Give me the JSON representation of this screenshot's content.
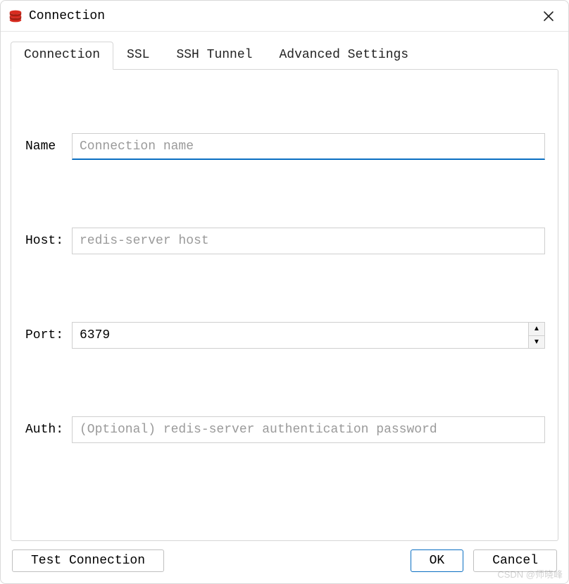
{
  "window": {
    "title": "Connection"
  },
  "tabs": [
    {
      "label": "Connection",
      "active": true
    },
    {
      "label": "SSL",
      "active": false
    },
    {
      "label": "SSH Tunnel",
      "active": false
    },
    {
      "label": "Advanced Settings",
      "active": false
    }
  ],
  "form": {
    "name": {
      "label": "Name",
      "value": "",
      "placeholder": "Connection name"
    },
    "host": {
      "label": "Host:",
      "value": "",
      "placeholder": "redis-server host"
    },
    "port": {
      "label": "Port:",
      "value": "6379"
    },
    "auth": {
      "label": "Auth:",
      "value": "",
      "placeholder": "(Optional) redis-server authentication password"
    }
  },
  "buttons": {
    "test": "Test Connection",
    "ok": "OK",
    "cancel": "Cancel"
  },
  "watermark": "CSDN @师晓峰"
}
